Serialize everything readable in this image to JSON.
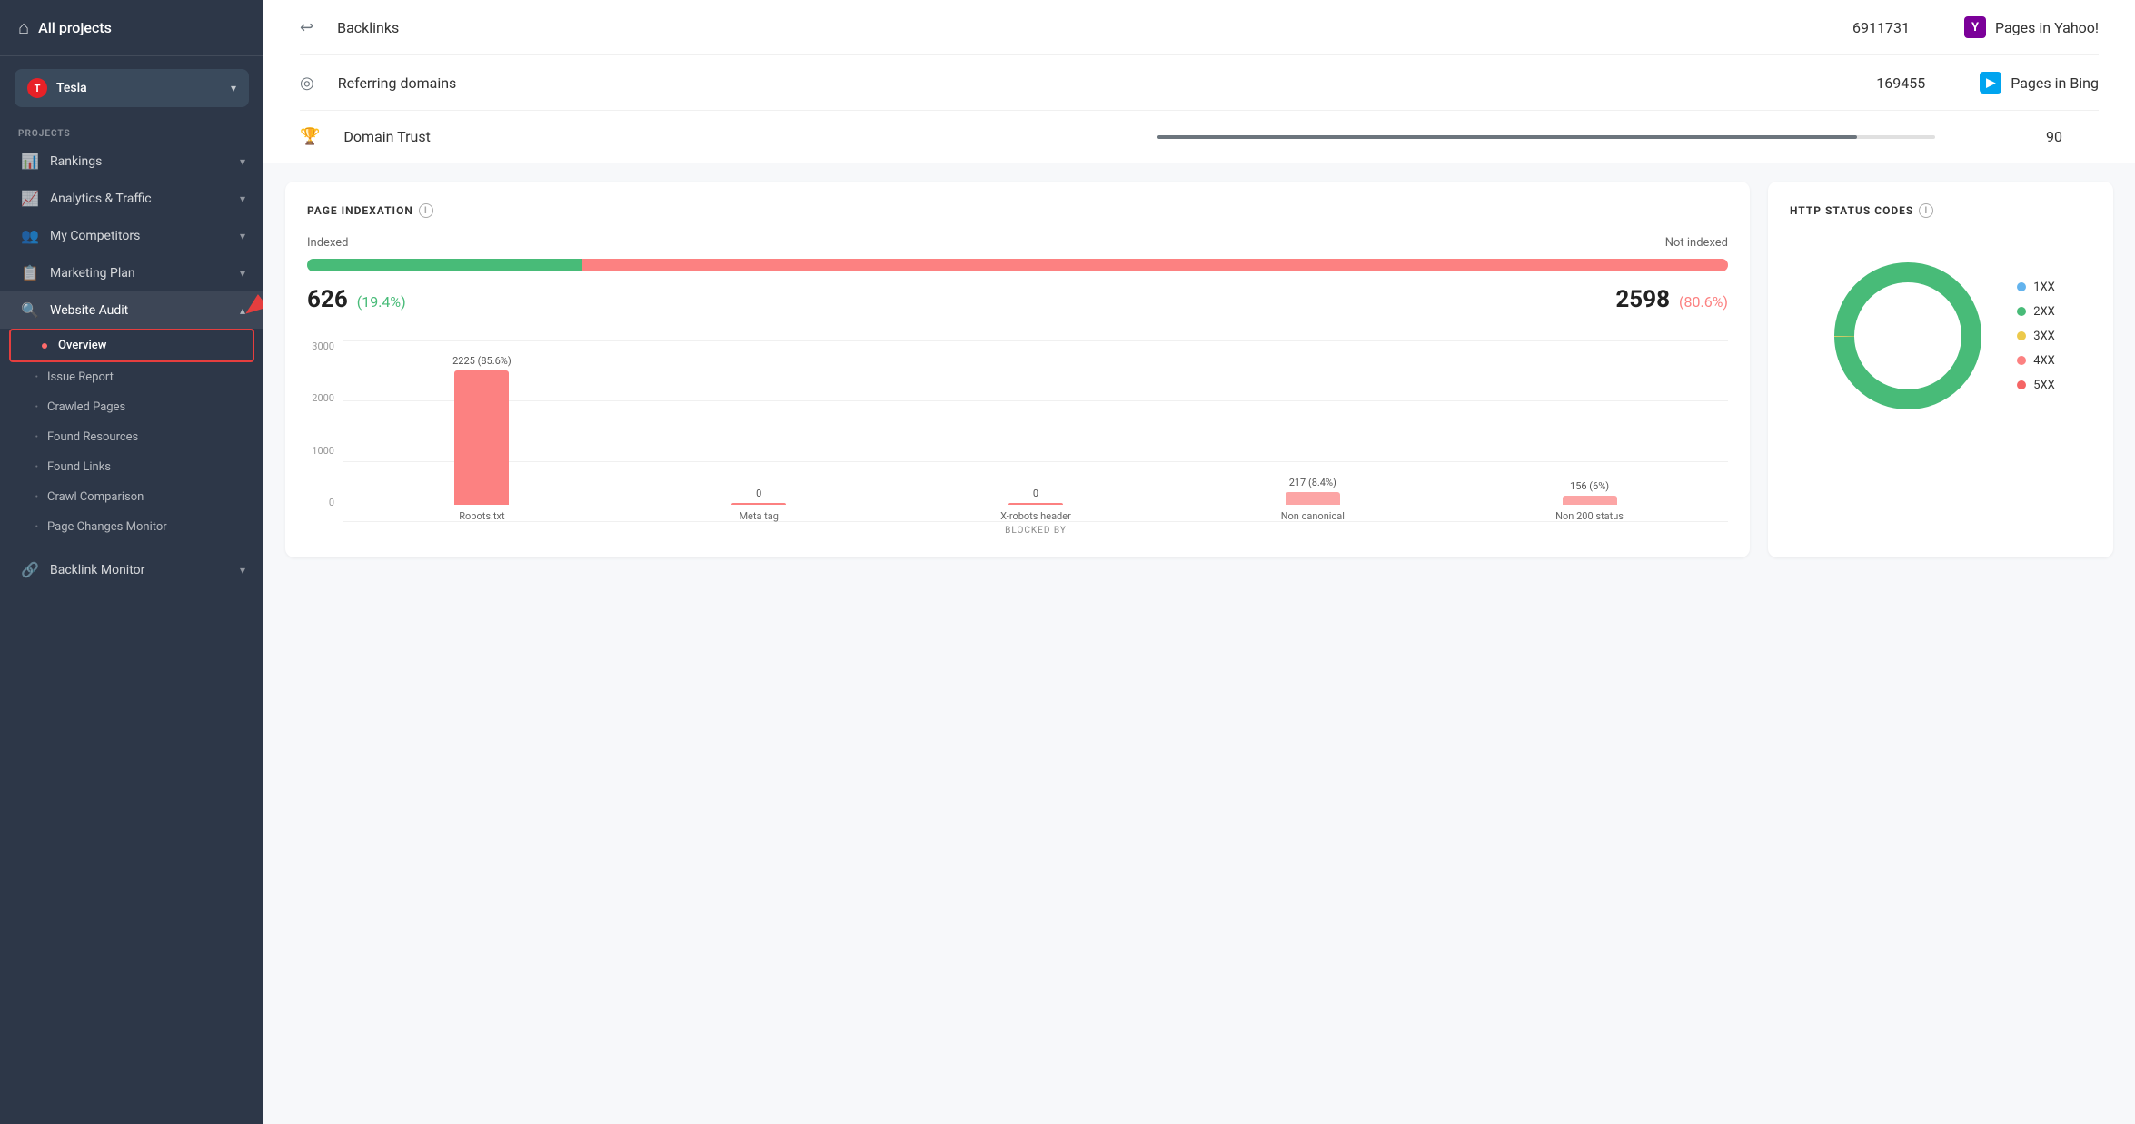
{
  "sidebar": {
    "all_projects": "All projects",
    "project_name": "Tesla",
    "section_label": "PROJECTS",
    "nav_items": [
      {
        "id": "rankings",
        "label": "Rankings",
        "icon": "📊",
        "expandable": true
      },
      {
        "id": "analytics-traffic",
        "label": "Analytics & Traffic",
        "icon": "📈",
        "expandable": true
      },
      {
        "id": "my-competitors",
        "label": "My Competitors",
        "icon": "👥",
        "expandable": true
      },
      {
        "id": "marketing-plan",
        "label": "Marketing Plan",
        "icon": "📋",
        "expandable": true
      },
      {
        "id": "website-audit",
        "label": "Website Audit",
        "icon": "🔍",
        "expandable": true,
        "expanded": true
      }
    ],
    "subitems": [
      {
        "id": "overview",
        "label": "Overview",
        "active": true
      },
      {
        "id": "issue-report",
        "label": "Issue Report"
      },
      {
        "id": "crawled-pages",
        "label": "Crawled Pages"
      },
      {
        "id": "found-resources",
        "label": "Found Resources"
      },
      {
        "id": "found-links",
        "label": "Found Links"
      },
      {
        "id": "crawl-comparison",
        "label": "Crawl Comparison"
      },
      {
        "id": "page-changes",
        "label": "Page Changes Monitor"
      }
    ],
    "bottom_items": [
      {
        "id": "backlink-monitor",
        "label": "Backlink Monitor",
        "icon": "🔗",
        "expandable": true
      }
    ]
  },
  "stats": {
    "backlinks": {
      "label": "Backlinks",
      "value": "6911731",
      "icon": "🔗"
    },
    "referring_domains": {
      "label": "Referring domains",
      "value": "169455",
      "icon": "◎"
    },
    "domain_trust": {
      "label": "Domain Trust",
      "value": "90",
      "icon": "🏆"
    },
    "pages_yahoo": {
      "label": "Pages in Yahoo!",
      "icon": "Y"
    },
    "pages_bing": {
      "label": "Pages in Bing",
      "icon": "B"
    }
  },
  "page_indexation": {
    "title": "PAGE INDEXATION",
    "indexed_label": "Indexed",
    "not_indexed_label": "Not indexed",
    "indexed_count": "626",
    "indexed_pct": "(19.4%)",
    "not_indexed_count": "2598",
    "not_indexed_pct": "(80.6%)",
    "green_width_pct": 19.4,
    "red_width_pct": 80.6,
    "y_axis": [
      "3000",
      "2000",
      "1000",
      "0"
    ],
    "bars": [
      {
        "label": "Robots.txt",
        "value": 2225,
        "pct": "(85.6%)",
        "height_pct": 74,
        "color": "red-bar"
      },
      {
        "label": "Meta tag",
        "value": 0,
        "pct": "0",
        "height_pct": 0,
        "color": "red-bar"
      },
      {
        "label": "X-robots header",
        "value": 0,
        "pct": "0",
        "height_pct": 0,
        "color": "red-bar"
      },
      {
        "label": "Non canonical",
        "value": 217,
        "pct": "(8.4%)",
        "height_pct": 7.2,
        "color": "pink-bar"
      },
      {
        "label": "Non 200 status",
        "value": 156,
        "pct": "(6%)",
        "height_pct": 5.2,
        "color": "pink-bar"
      }
    ],
    "x_axis_label": "BLOCKED BY"
  },
  "http_status": {
    "title": "HTTP STATUS CODES",
    "legend": [
      {
        "code": "1XX",
        "color": "#63b3ed"
      },
      {
        "code": "2XX",
        "color": "#48bb78"
      },
      {
        "code": "3XX",
        "color": "#ecc94b"
      },
      {
        "code": "4XX",
        "color": "#fc8181"
      },
      {
        "code": "5XX",
        "color": "#f56565"
      }
    ],
    "donut": {
      "segments": [
        {
          "color": "#48bb78",
          "pct": 88
        },
        {
          "color": "#ecc94b",
          "pct": 5
        },
        {
          "color": "#fc8181",
          "pct": 4
        },
        {
          "color": "#f56565",
          "pct": 2
        },
        {
          "color": "#63b3ed",
          "pct": 1
        }
      ]
    }
  },
  "colors": {
    "sidebar_bg": "#2d3748",
    "accent_red": "#e53e3e",
    "green": "#48bb78",
    "red_bar": "#fc8181"
  }
}
